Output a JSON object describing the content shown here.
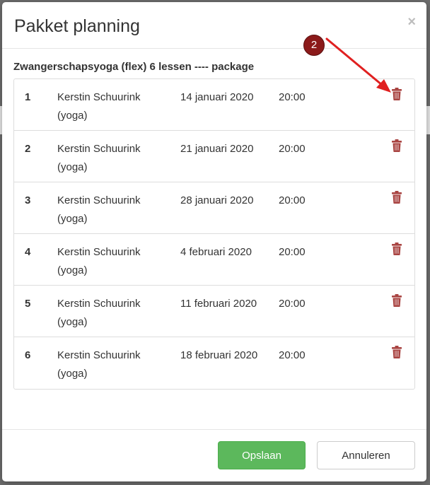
{
  "modal": {
    "title": "Pakket planning",
    "close_glyph": "×",
    "package_title": "Zwangerschapsyoga (flex) 6 lessen ---- package"
  },
  "lessons": [
    {
      "num": "1",
      "teacher": "Kerstin Schuurink (yoga)",
      "date": "14 januari 2020",
      "time": "20:00"
    },
    {
      "num": "2",
      "teacher": "Kerstin Schuurink (yoga)",
      "date": "21 januari 2020",
      "time": "20:00"
    },
    {
      "num": "3",
      "teacher": "Kerstin Schuurink (yoga)",
      "date": "28 januari 2020",
      "time": "20:00"
    },
    {
      "num": "4",
      "teacher": "Kerstin Schuurink (yoga)",
      "date": "4 februari 2020",
      "time": "20:00"
    },
    {
      "num": "5",
      "teacher": "Kerstin Schuurink (yoga)",
      "date": "11 februari 2020",
      "time": "20:00"
    },
    {
      "num": "6",
      "teacher": "Kerstin Schuurink (yoga)",
      "date": "18 februari 2020",
      "time": "20:00"
    }
  ],
  "footer": {
    "save_label": "Opslaan",
    "cancel_label": "Annuleren"
  },
  "annotation": {
    "badge": "2"
  },
  "colors": {
    "trash": "#a94442",
    "save": "#5cb85c",
    "annotation": "#8b1a1a",
    "arrow": "#e02020"
  },
  "icons": {
    "delete": "trash-icon",
    "close": "close-icon"
  }
}
